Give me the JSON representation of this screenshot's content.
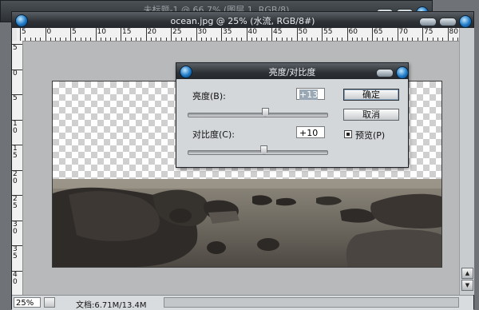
{
  "back_window": {
    "title": "未标题-1 @ 66.7% (图层 1, RGB/8)"
  },
  "main_window": {
    "title": "ocean.jpg @ 25% (水流, RGB/8#)",
    "ruler_top_labels": [
      "5",
      "0",
      "5",
      "10",
      "15",
      "20",
      "25",
      "30",
      "35",
      "40",
      "45",
      "50",
      "55",
      "60",
      "65",
      "70",
      "75",
      "80"
    ],
    "ruler_left_labels": [
      "5",
      "0",
      "5",
      "1 0",
      "1 5",
      "2 0",
      "2 5",
      "3 0",
      "3 5",
      "4 0"
    ],
    "zoom": "25%",
    "doc_info": "文档:6.71M/13.4M"
  },
  "dialog": {
    "title": "亮度/对比度",
    "brightness_label": "亮度(B):",
    "brightness_value": "+13",
    "brightness_level": 0.56,
    "contrast_label": "对比度(C):",
    "contrast_value": "+10",
    "contrast_level": 0.55,
    "ok_label": "确定",
    "cancel_label": "取消",
    "preview_label": "预览(P)",
    "preview_checked": true
  },
  "colors": {
    "accent_orb": "#1d78c4",
    "titlebar_dark": "#2d3136"
  }
}
